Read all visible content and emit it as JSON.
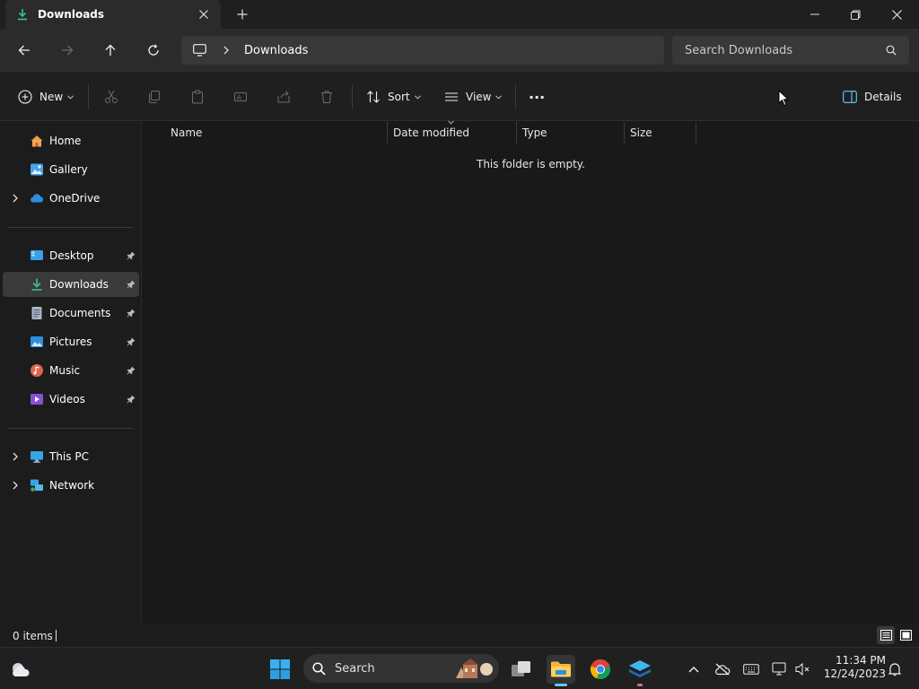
{
  "window": {
    "tab_title": "Downloads",
    "new_tab": "+"
  },
  "nav": {
    "breadcrumb": [
      "Downloads"
    ],
    "search_placeholder": "Search Downloads"
  },
  "toolbar": {
    "new_label": "New",
    "sort_label": "Sort",
    "view_label": "View",
    "more_label": "···",
    "details_label": "Details"
  },
  "sidebar": {
    "top": [
      {
        "label": "Home",
        "icon": "home-icon"
      },
      {
        "label": "Gallery",
        "icon": "gallery-icon"
      },
      {
        "label": "OneDrive",
        "icon": "onedrive-icon"
      }
    ],
    "pinned": [
      {
        "label": "Desktop",
        "icon": "desktop-icon"
      },
      {
        "label": "Downloads",
        "icon": "downloads-icon"
      },
      {
        "label": "Documents",
        "icon": "documents-icon"
      },
      {
        "label": "Pictures",
        "icon": "pictures-icon"
      },
      {
        "label": "Music",
        "icon": "music-icon"
      },
      {
        "label": "Videos",
        "icon": "videos-icon"
      }
    ],
    "bottom": [
      {
        "label": "This PC",
        "icon": "pc-icon"
      },
      {
        "label": "Network",
        "icon": "network-icon"
      }
    ],
    "selected": "Downloads"
  },
  "main": {
    "columns": [
      "Name",
      "Date modified",
      "Type",
      "Size"
    ],
    "empty_message": "This folder is empty."
  },
  "status": {
    "item_count": "0 items"
  },
  "taskbar": {
    "search_label": "Search",
    "time": "11:34 PM",
    "date": "12/24/2023"
  },
  "colors": {
    "accent": "#60cdff",
    "background": "#191919",
    "panel": "#2b2b2b"
  }
}
